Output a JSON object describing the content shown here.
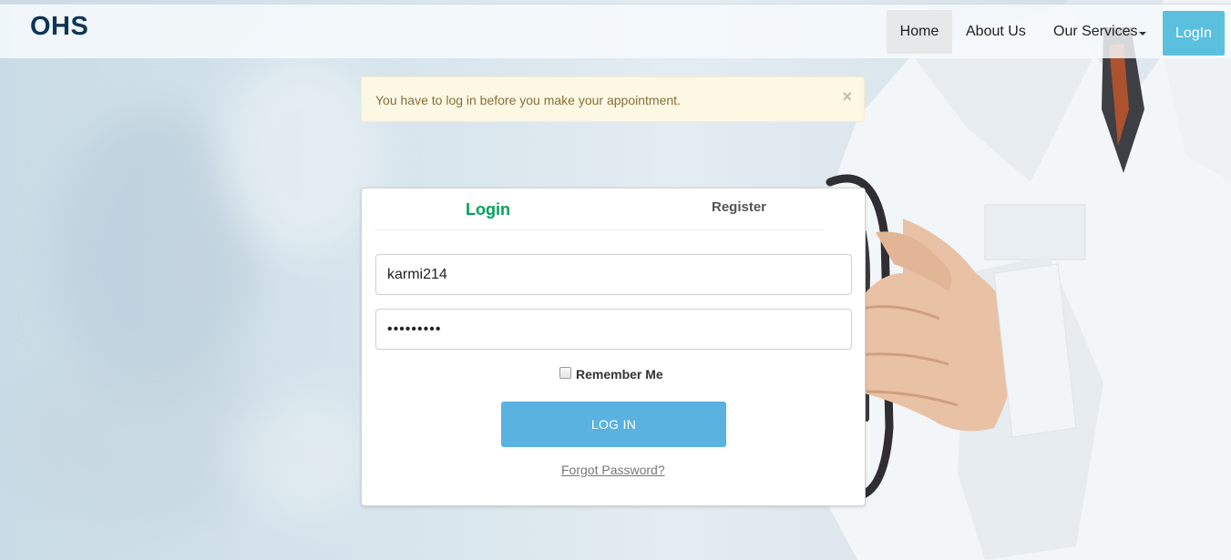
{
  "nav": {
    "brand": "OHS",
    "home": "Home",
    "about": "About Us",
    "services": "Our Services",
    "login": "LogIn"
  },
  "alert": {
    "message": "You have to log in before you make your appointment.",
    "close_symbol": "×"
  },
  "login_form": {
    "tabs": {
      "login": "Login",
      "register": "Register"
    },
    "username_value": "karmi214",
    "password_value": "•••••••••",
    "remember_label": "Remember Me",
    "remember_checked": false,
    "submit_label": "LOG IN",
    "forgot_label": "Forgot Password?"
  },
  "colors": {
    "brand": "#0f3556",
    "accent_login_tab": "#029f5b",
    "nav_login_bg": "#5bc0de",
    "submit_bg": "#59b2e0",
    "alert_bg": "#fcf8e3",
    "alert_text": "#8a6d3b"
  },
  "icons": {
    "alert_close": "close-icon",
    "services_dropdown": "caret-down-icon",
    "background": "doctor-image"
  }
}
